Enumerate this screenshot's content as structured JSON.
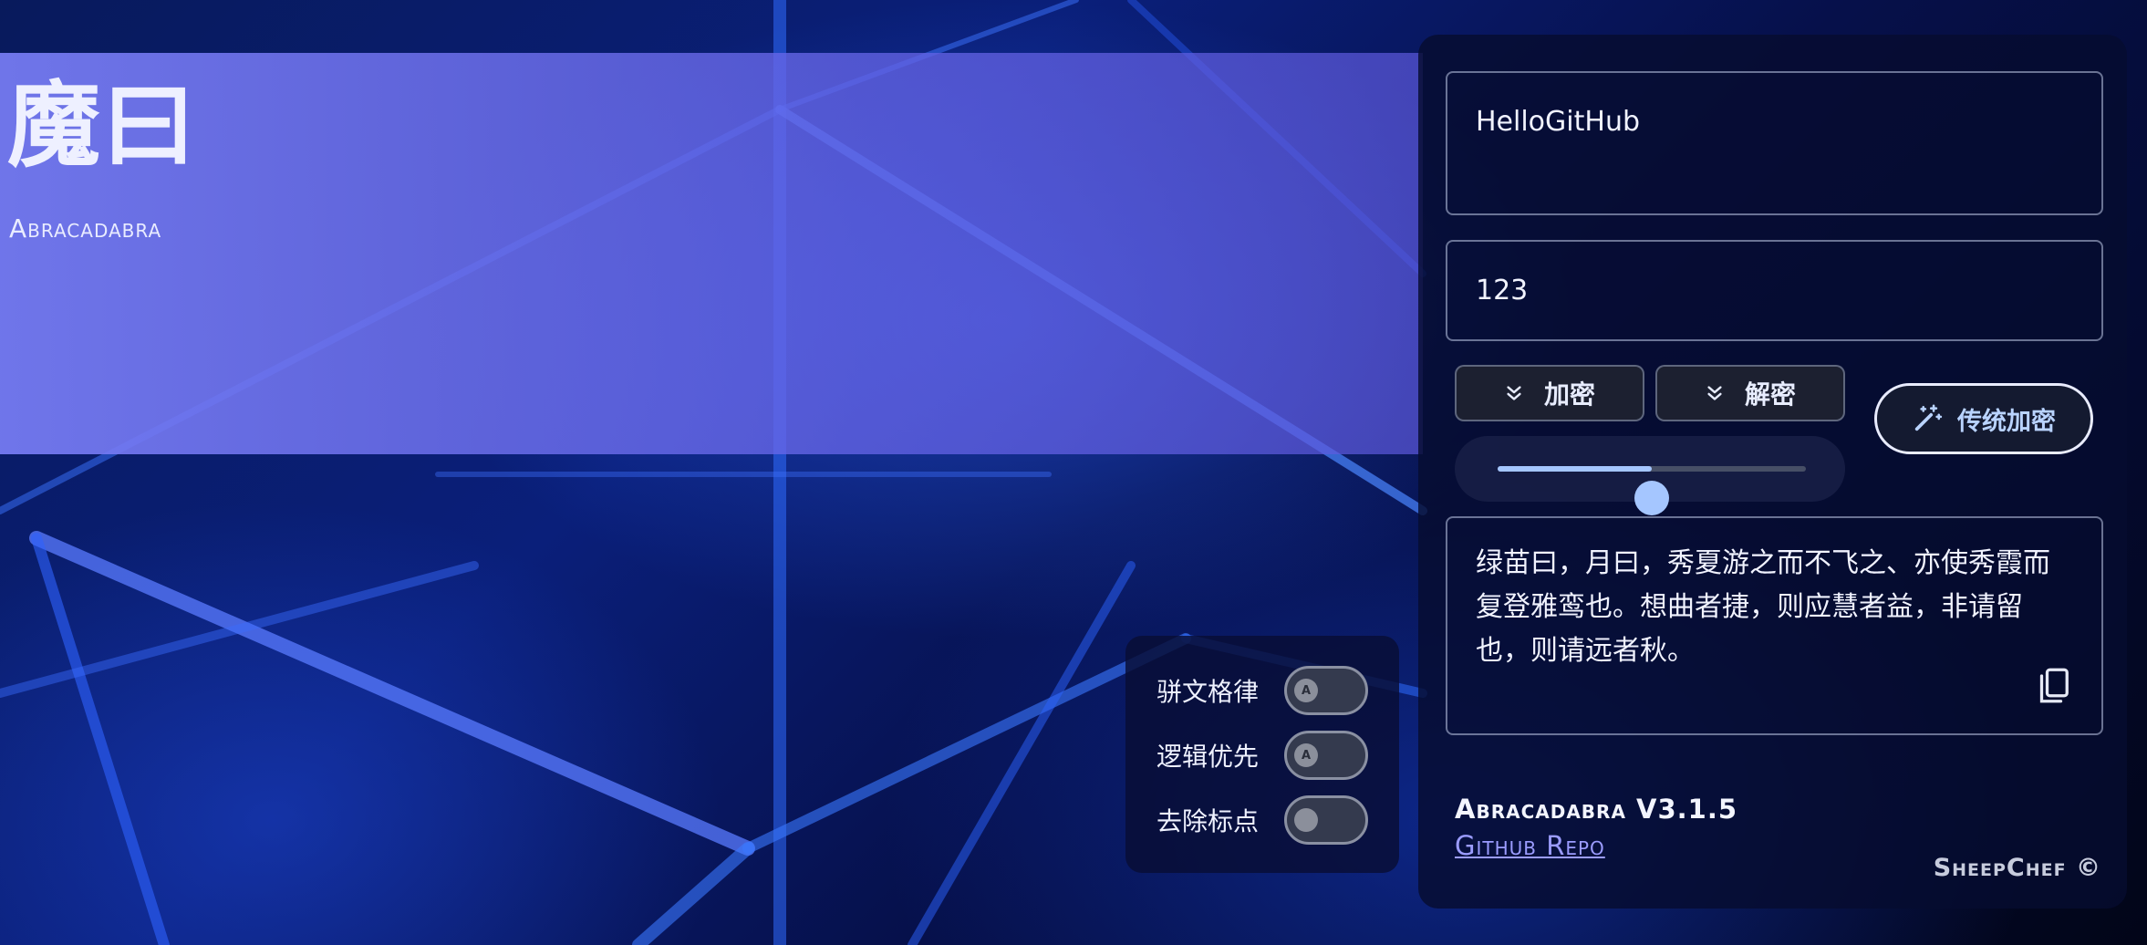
{
  "hero": {
    "title": "魔曰",
    "subtitle": "Abracadabra"
  },
  "panel": {
    "input_text": "HelloGitHub",
    "key_text": "123",
    "encrypt_label": "加密",
    "decrypt_label": "解密",
    "traditional_label": "传统加密",
    "slider_value": 0.5,
    "output_text": "绿苗曰，月曰，秀夏游之而不飞之、亦使秀霞而复登雅鸾也。想曲者捷，则应慧者益，非请留也，则请远者秋。",
    "version": "Abracadabra V3.1.5",
    "repo_link": "Github Repo",
    "credit": "SheepChef ©"
  },
  "options": [
    {
      "label": "骈文格律",
      "state": "A"
    },
    {
      "label": "逻辑优先",
      "state": "A"
    },
    {
      "label": "去除标点",
      "state": ""
    }
  ],
  "colors": {
    "accent": "#a5c6ff",
    "hero_band": "#7b7ff0",
    "link": "#9b9cff",
    "panel_bg": "#060c30"
  },
  "icons": {
    "encrypt": "double-chevron-down-icon",
    "decrypt": "double-chevron-down-icon",
    "traditional": "magic-wand-icon",
    "copy": "copy-icon"
  }
}
